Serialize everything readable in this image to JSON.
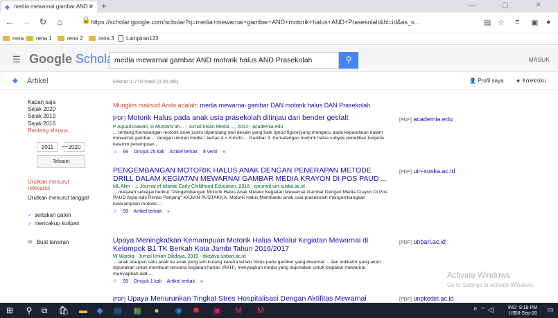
{
  "browser": {
    "tab_title": "media mewarnai gambar AND ✓",
    "tab_close": "×",
    "new_tab": "+",
    "window_controls": "— ▢ ✕",
    "url": "https://scholar.google.com/scholar?q=media+mewarnai+gambar+AND+motorik+halus+AND+Prasekolah&hl=id&as_s...",
    "bookmarks": [
      "rena",
      "rena 1",
      "rena 2",
      "rena 3",
      "Lampiran123"
    ]
  },
  "scholar": {
    "logo_google": "Google",
    "logo_scholar": "Scholar",
    "query": "media mewarnai gambar AND motorik halus AND Prasekolah",
    "signin": "MASUK",
    "section": "Artikel",
    "count": "Sekitar 1.770 hasil (0,06 dtk)",
    "profile": "Profil saya",
    "library": "Koleksiku",
    "suggestion_prefix": "Mungkin maksud Anda adalah: ",
    "suggestion": "media mewarnai gambar DAN motorik halus DAN Prasekolah"
  },
  "sidebar": {
    "time_any": "Kapan saja",
    "since_2020": "Sejak 2020",
    "since_2019": "Sejak 2019",
    "since_2016": "Sejak 2016",
    "custom": "Rentang khusus...",
    "from": "2011",
    "to": "2020",
    "dash": "—",
    "search_btn": "Telusuri",
    "sort_relevance": "Urutkan menurut relevansi",
    "sort_date": "Urutkan menurut tanggal",
    "patents": "sertakan paten",
    "citations": "mencakup kutipan",
    "alert": "Buat lansiran"
  },
  "results": [
    {
      "tag": "[PDF]",
      "title": "Motorik Halus pada anak usia prasekolah ditinjau dari bender gestalt",
      "meta": "P Aquarisnawati, D Mustami'ah... - Jurnal Insan Media ..., 2012 - academia.edu",
      "snippet": "... tentang Kematangan motorik anak justru dipandang dari desain yang baik (good figure)yang mengacu pada kepandaian dalam mewarnai gambar ... dengan ukuran media / kertas 4 × 6 inchi ... Gambar 3. Kematangan motorik halus subyek penelitian berjenis kelamin perempuan ...",
      "actions": [
        "☆",
        "99",
        "Dirujuk 25 kali",
        "Artikel terkait",
        "8 versi",
        "»"
      ],
      "side": "academia.edu"
    },
    {
      "tag": "",
      "title": "PENGEMBANGAN MOTORIK HALUS ANAK DENGAN PENERAPAN METODE DRILL DALAM KEGIATAN MEWARNAI GAMBAR MEDIA KRAYON DI POS PAUD ...",
      "meta": "ML Alim - ... Journal of Islamic Early Childhood Education, 2018 - ejournal.uin-suska.ac.id",
      "snippet": "... masalah sebagai berikut \"Pengembangan Motorik Halus Anak Melalui Kegiatan Mewarnai Gambar Dengan Media Crayon Di Pos PAUD Aqila kids Rimbo Panjang\" KAJIAN PUSTAKA A. Motorik Halus Membantu anak usia prasekolah mengembangkan keterampilan motorik ...",
      "actions": [
        "☆",
        "99",
        "Artikel terkait",
        "»"
      ],
      "side": "uin-suska.ac.id"
    },
    {
      "tag": "",
      "title": "Upaya Meningkatkan Kemampuan Motorik Halus Melalui Kegiatan Mewarnai di Kelompok B1 TK Berkah Kota Jambi Tahun 2016/2017",
      "meta": "W Wardia - Jurnal Ilmiah Dikdaya, 2019 - dikdaya.unbari.ac.id",
      "snippet": "... anak ataupun satu anak ke anak yang lain kurang karena terlalu fokus pada gambar yang diwarnai ... dan indikator yang akan digunakan untuk membuat rencana kegiatan harian (RKH), menyiapkan media yang digunakan untuk kegiatan mewarnai, menyiapkan alat ...",
      "actions": [
        "☆",
        "99",
        "Dirujuk 1 kali",
        "Artikel terkait",
        "»"
      ],
      "side": "unbari.ac.id"
    },
    {
      "tag": "[PDF]",
      "title": "Upaya Menurunkan Tingkat Stres Hospitalisasi Dengan Aktifitas Mewarnai",
      "side": "unpkediri.ac.id"
    }
  ],
  "watermark": {
    "line1": "Activate Windows",
    "line2": "Go to Settings to activate Windows."
  },
  "taskbar": {
    "ime_top": "IND",
    "ime_bottom": "US",
    "time": "9:18 PM",
    "date": "08-Sep-20"
  }
}
